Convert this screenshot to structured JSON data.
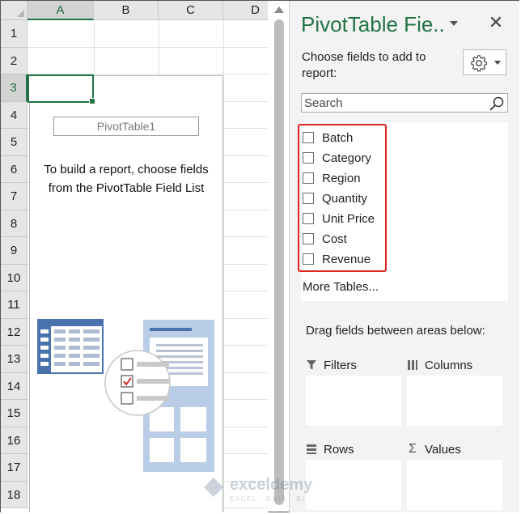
{
  "sheet": {
    "columns": [
      "A",
      "B",
      "C",
      "D"
    ],
    "rows": [
      "1",
      "2",
      "3",
      "4",
      "5",
      "6",
      "7",
      "8",
      "9",
      "10",
      "11",
      "12",
      "13",
      "14",
      "15",
      "16",
      "17",
      "18"
    ],
    "selected_column": "A",
    "selected_row": "3"
  },
  "pivot": {
    "name": "PivotTable1",
    "instruction_line1": "To build a report, choose fields",
    "instruction_line2": "from the PivotTable Field List"
  },
  "field_pane": {
    "title": "PivotTable Fie..",
    "choose_label": "Choose fields to add to report:",
    "search_placeholder": "Search",
    "fields": [
      {
        "label": "Batch",
        "checked": false
      },
      {
        "label": "Category",
        "checked": false
      },
      {
        "label": "Region",
        "checked": false
      },
      {
        "label": "Quantity",
        "checked": false
      },
      {
        "label": "Unit Price",
        "checked": false
      },
      {
        "label": "Cost",
        "checked": false
      },
      {
        "label": "Revenue",
        "checked": false
      }
    ],
    "more_tables": "More Tables...",
    "drag_label": "Drag fields between areas below:",
    "areas": {
      "filters": "Filters",
      "columns": "Columns",
      "rows": "Rows",
      "values": "Values"
    }
  },
  "watermark": {
    "name": "exceldemy",
    "tagline": "EXCEL · DATA · BI"
  },
  "colors": {
    "accent_green": "#217346",
    "highlight_red": "#e02424",
    "illustration_blue": "#4a72ad"
  }
}
